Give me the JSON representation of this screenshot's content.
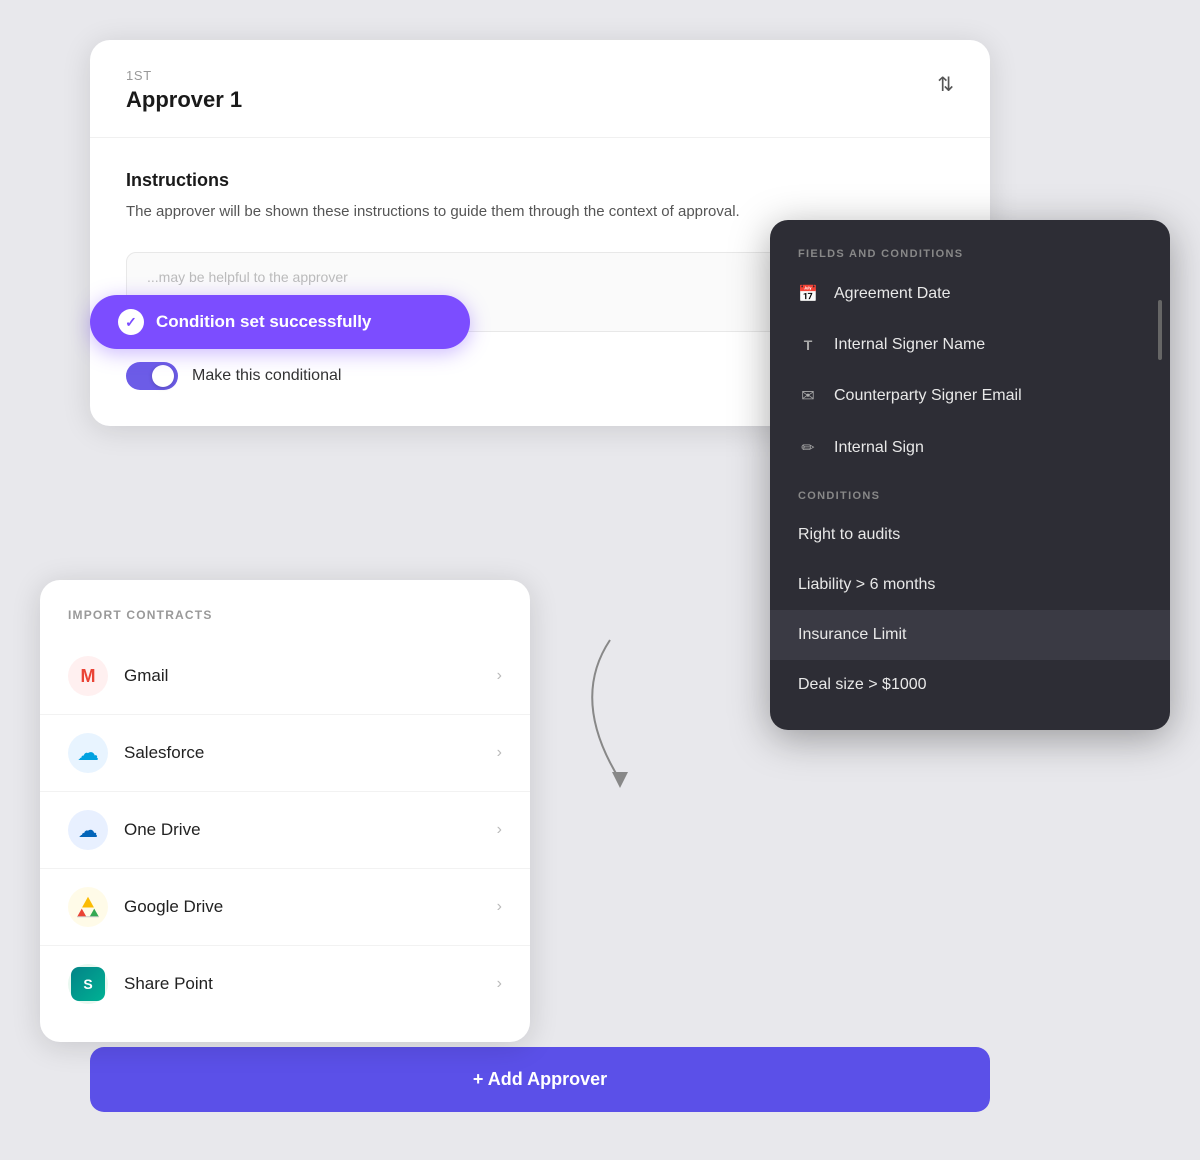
{
  "approver_card": {
    "order_label": "1ST",
    "title": "Approver 1",
    "instructions_heading": "Instructions",
    "instructions_body": "The approver will be shown these instructions to guide them through the context of approval.",
    "textarea_placeholder": "...may be helpful to the approver",
    "toggle_label": "Make this conditional",
    "add_approver_label": "+ Add Approver"
  },
  "success_toast": {
    "message": "Condition set successfully"
  },
  "import_panel": {
    "section_title": "IMPORT CONTRACTS",
    "items": [
      {
        "id": "gmail",
        "label": "Gmail"
      },
      {
        "id": "salesforce",
        "label": "Salesforce"
      },
      {
        "id": "onedrive",
        "label": "One Drive"
      },
      {
        "id": "gdrive",
        "label": "Google Drive"
      },
      {
        "id": "sharepoint",
        "label": "Share Point"
      }
    ]
  },
  "fields_panel": {
    "fields_section_title": "FIELDS AND CONDITIONS",
    "fields": [
      {
        "id": "agreement-date",
        "label": "Agreement Date",
        "icon": "📅"
      },
      {
        "id": "internal-signer-name",
        "label": "Internal Signer Name",
        "icon": "T"
      },
      {
        "id": "counterparty-signer-email",
        "label": "Counterparty Signer Email",
        "icon": "✉"
      },
      {
        "id": "internal-sign",
        "label": "Internal Sign",
        "icon": "✏"
      }
    ],
    "conditions_section_title": "CONDITIONS",
    "conditions": [
      {
        "id": "right-to-audits",
        "label": "Right to audits"
      },
      {
        "id": "liability-6-months",
        "label": "Liability > 6 months"
      },
      {
        "id": "insurance-limit",
        "label": "Insurance Limit"
      },
      {
        "id": "deal-size",
        "label": "Deal size > $1000"
      }
    ]
  },
  "colors": {
    "purple_accent": "#7c4dff",
    "toggle_on": "#6c5ce7",
    "add_btn": "#5b50e8",
    "dark_panel": "#2d2d35"
  }
}
